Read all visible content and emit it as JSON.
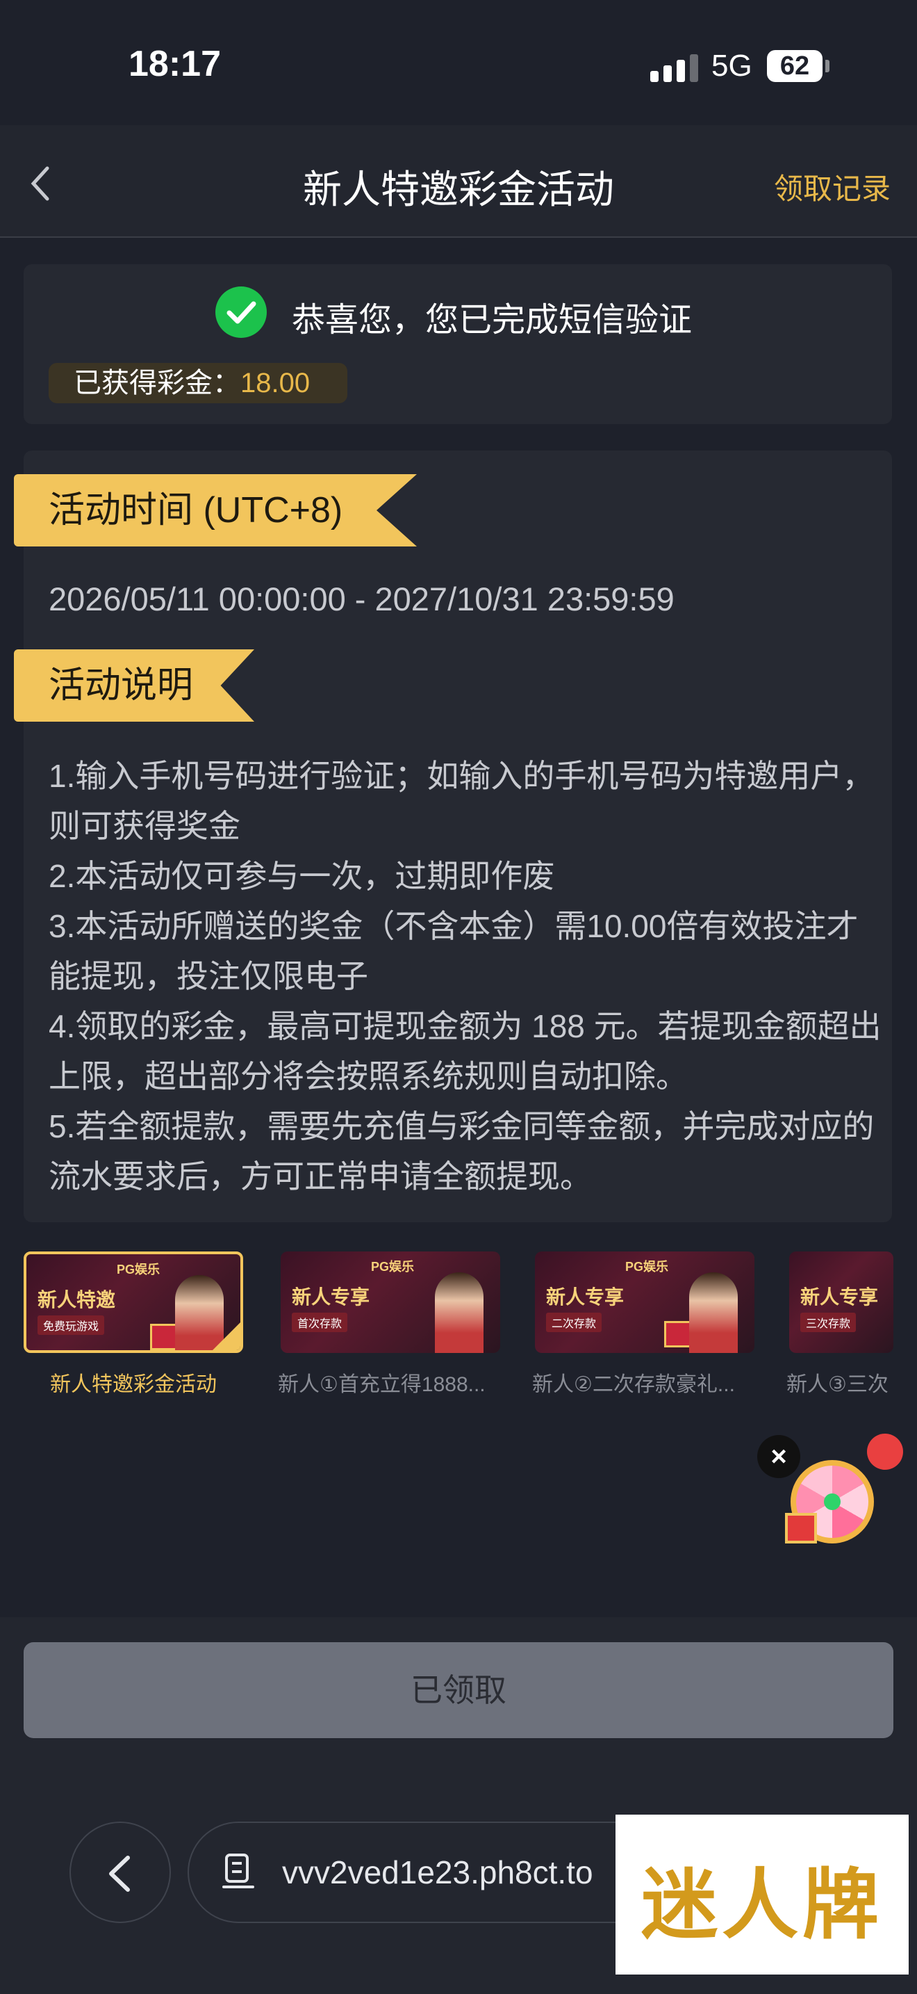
{
  "status_bar": {
    "time": "18:17",
    "network": "5G",
    "battery": "62"
  },
  "header": {
    "title": "新人特邀彩金活动",
    "records_label": "领取记录"
  },
  "verification": {
    "message": "恭喜您，您已完成短信验证",
    "bonus_label": "已获得彩金：",
    "bonus_value": "18.00"
  },
  "activity": {
    "time_title": "活动时间 (UTC+8)",
    "time_range": "2026/05/11 00:00:00 - 2027/10/31 23:59:59",
    "desc_title": "活动说明",
    "rules": [
      "1.输入手机号码进行验证；如输入的手机号码为特邀用户，则可获得奖金",
      "2.本活动仅可参与一次，过期即作废",
      "3.本活动所赠送的奖金（不含本金）需10.00倍有效投注才能提现，投注仅限电子",
      "4.领取的彩金，最高可提现金额为 188 元。若提现金额超出上限，超出部分将会按照系统规则自动扣除。",
      "5.若全额提款，需要先充值与彩金同等金额，并完成对应的流水要求后，方可正常申请全额提现。"
    ]
  },
  "promotions": [
    {
      "label": "新人特邀彩金活动",
      "banner_title": "新人特邀",
      "banner_sub": "免费玩游戏",
      "active": true
    },
    {
      "label": "新人①首充立得1888...",
      "banner_title": "新人专享",
      "banner_sub": "首次存款",
      "active": false
    },
    {
      "label": "新人②二次存款豪礼...",
      "banner_title": "新人专享",
      "banner_sub": "二次存款",
      "active": false
    },
    {
      "label": "新人③三次",
      "banner_title": "新人专享",
      "banner_sub": "三次存款",
      "active": false
    }
  ],
  "banner_logo": "PG娱乐",
  "claim_button": "已领取",
  "browser": {
    "url": "vvv2ved1e23.ph8ct.to"
  },
  "watermark": "迷人牌",
  "colors": {
    "accent": "#f2c55c",
    "success": "#1cc24c",
    "background": "#1e212b"
  }
}
